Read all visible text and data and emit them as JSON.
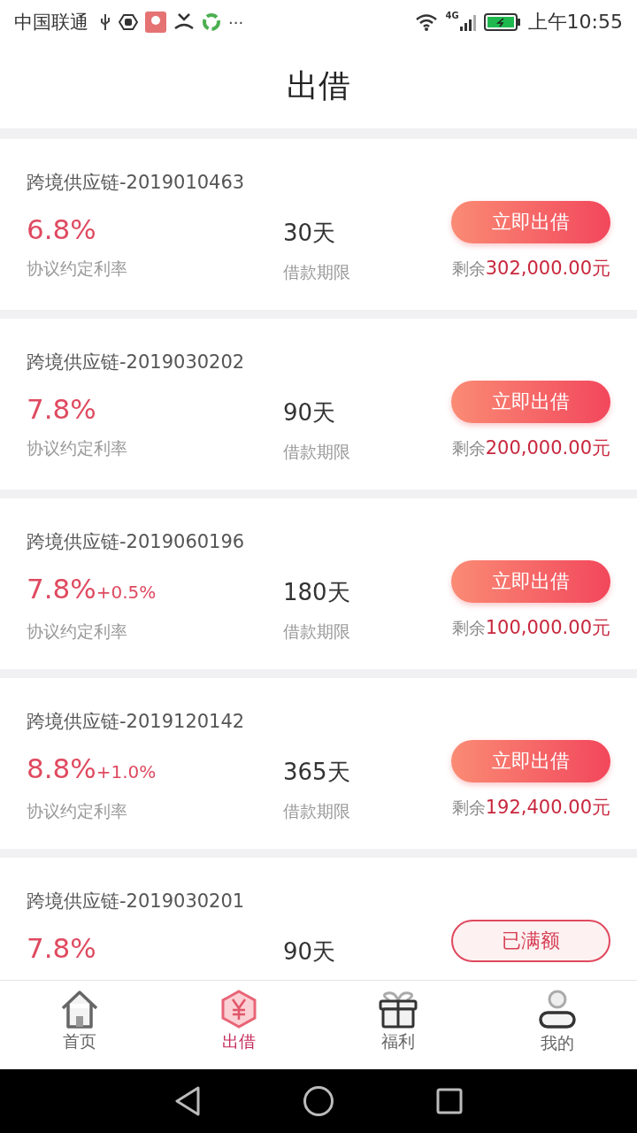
{
  "status_bar": {
    "carrier": "中国联通",
    "more": "···",
    "network": "4G",
    "time": "上午10:55"
  },
  "header": {
    "title": "出借"
  },
  "loans": [
    {
      "name": "跨境供应链-2019010463",
      "rate": "6.8%",
      "rate_label": "协议约定利率",
      "term": "30天",
      "term_label": "借款期限",
      "button": "立即出借",
      "full": false,
      "remaining_prefix": "剩余",
      "remaining_amount": "302,000.00元"
    },
    {
      "name": "跨境供应链-2019030202",
      "rate": "7.8%",
      "rate_label": "协议约定利率",
      "term": "90天",
      "term_label": "借款期限",
      "button": "立即出借",
      "full": false,
      "remaining_prefix": "剩余",
      "remaining_amount": "200,000.00元"
    },
    {
      "name": "跨境供应链-2019060196",
      "rate": "7.8%",
      "bonus": "+0.5%",
      "rate_label": "协议约定利率",
      "term": "180天",
      "term_label": "借款期限",
      "button": "立即出借",
      "full": false,
      "remaining_prefix": "剩余",
      "remaining_amount": "100,000.00元"
    },
    {
      "name": "跨境供应链-2019120142",
      "rate": "8.8%",
      "bonus": "+1.0%",
      "rate_label": "协议约定利率",
      "term": "365天",
      "term_label": "借款期限",
      "button": "立即出借",
      "full": false,
      "remaining_prefix": "剩余",
      "remaining_amount": "192,400.00元"
    },
    {
      "name": "跨境供应链-2019030201",
      "rate": "7.8%",
      "term": "90天",
      "button": "已满额",
      "full": true
    }
  ],
  "tabs": [
    {
      "label": "首页",
      "kind": "home",
      "selected": false
    },
    {
      "label": "出借",
      "kind": "yen",
      "selected": true
    },
    {
      "label": "福利",
      "kind": "gift",
      "selected": false
    },
    {
      "label": "我的",
      "kind": "user",
      "selected": false
    }
  ]
}
